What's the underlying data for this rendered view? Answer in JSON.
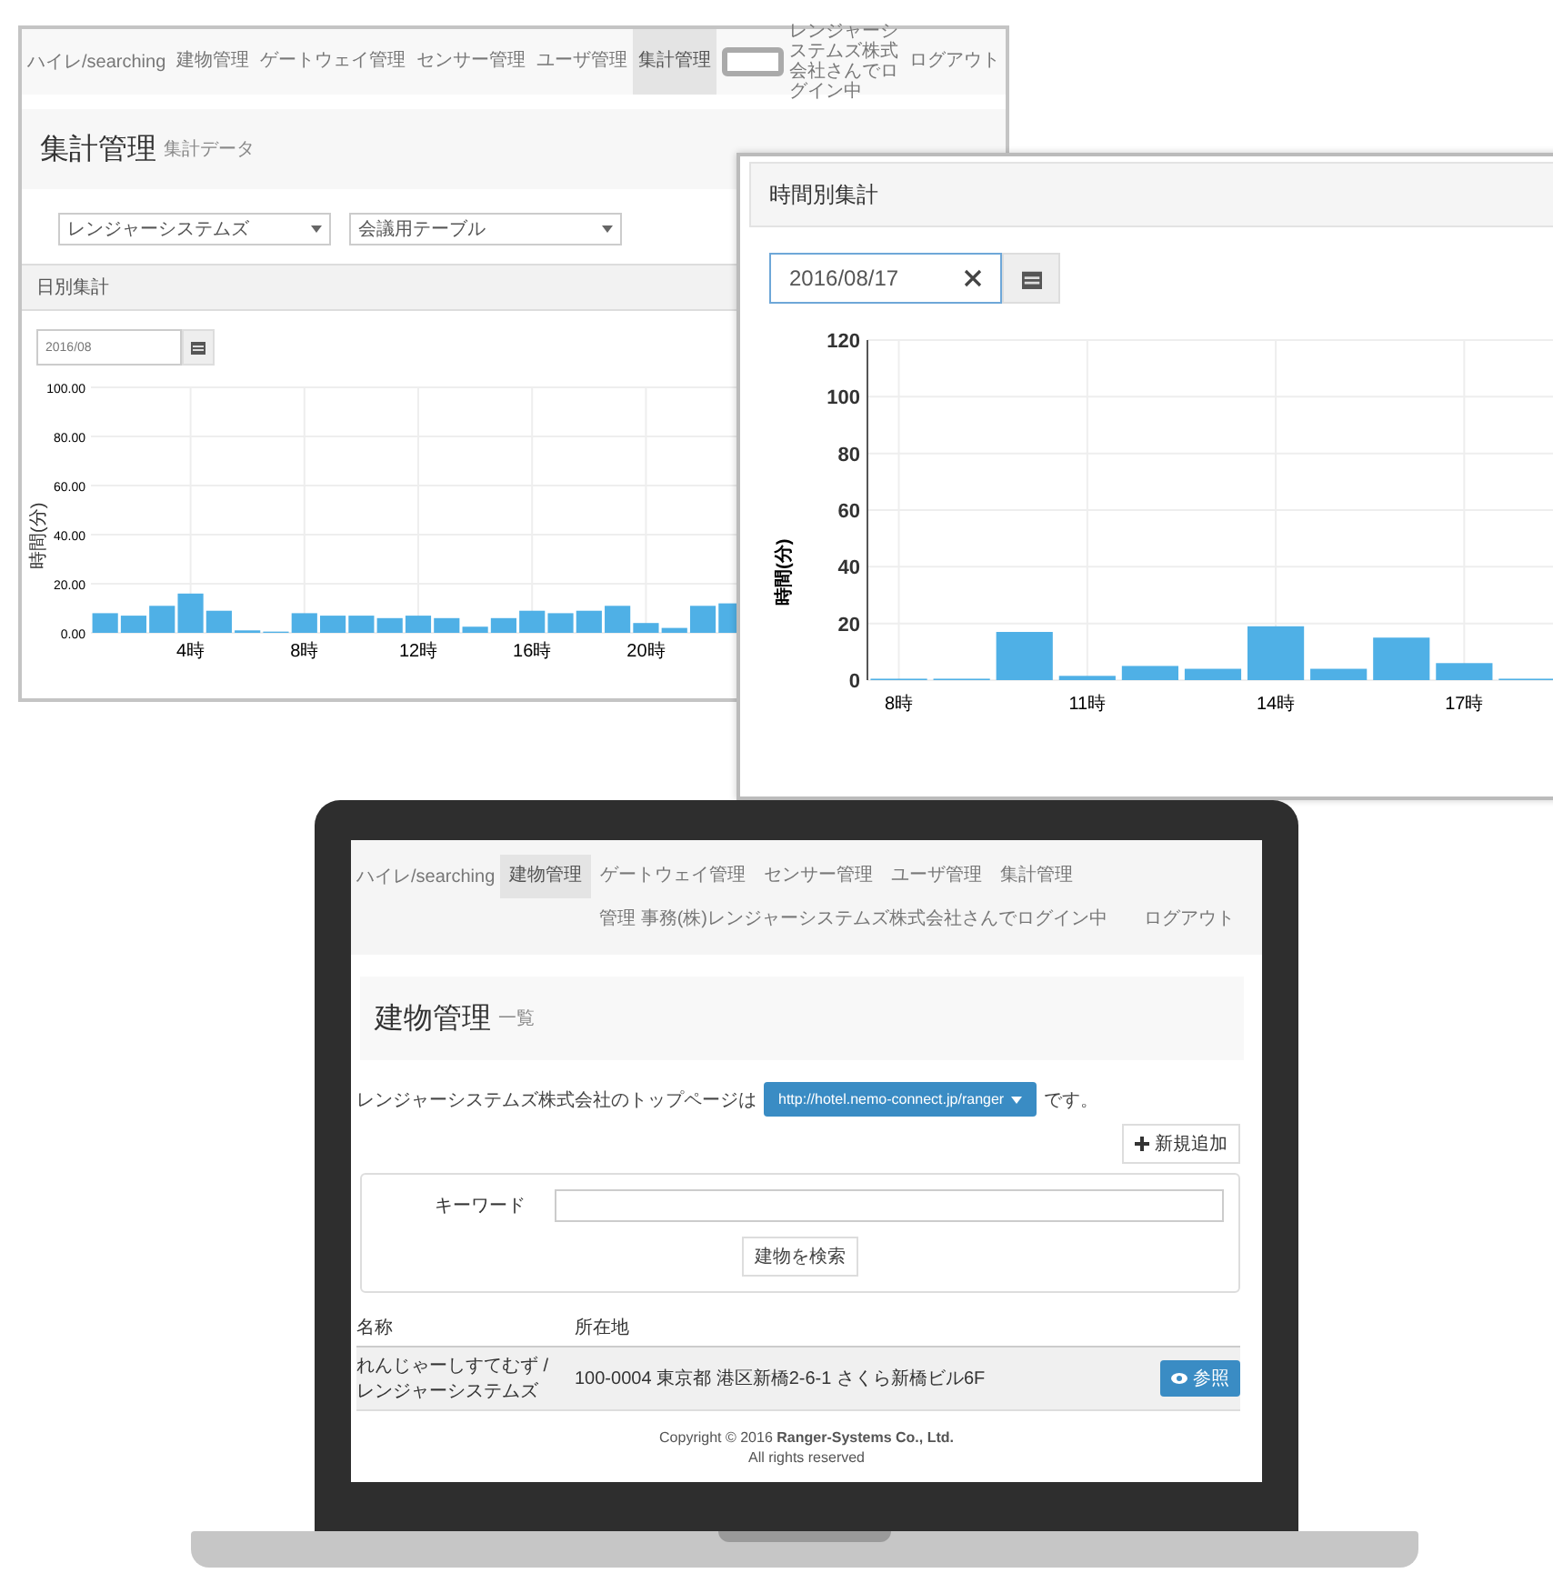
{
  "back_window": {
    "nav": {
      "brand": "ハイレ/searching",
      "items": [
        {
          "label": "建物管理",
          "selected": false
        },
        {
          "label": "ゲートウェイ管理",
          "selected": false
        },
        {
          "label": "センサー管理",
          "selected": false
        },
        {
          "label": "ユーザ管理",
          "selected": false
        },
        {
          "label": "集計管理",
          "selected": true
        }
      ],
      "user_text": "レンジャーシステムズ株式会社さんでログイン中",
      "logout": "ログアウト"
    },
    "heading": {
      "title": "集計管理",
      "subtitle": "集計データ"
    },
    "selects": [
      {
        "value": "レンジャーシステムズ"
      },
      {
        "value": "会議用テーブル"
      }
    ],
    "panel": {
      "title": "日別集計",
      "date": "2016/08",
      "chart_data": {
        "type": "bar",
        "grid": true,
        "ylabel": "時間(分)",
        "x": [
          1,
          2,
          3,
          4,
          5,
          6,
          7,
          8,
          9,
          10,
          11,
          12,
          13,
          14,
          15,
          16,
          17,
          18,
          19,
          20,
          21,
          22,
          23
        ],
        "xlim": [
          0.5,
          23.5
        ],
        "values": [
          8,
          7,
          11,
          16,
          9,
          1,
          0.5,
          8,
          7,
          7,
          6,
          7,
          6,
          2.5,
          6,
          9,
          8,
          9,
          11,
          4,
          2,
          11,
          12
        ],
        "ylim": [
          0,
          100
        ],
        "yticks": [
          {
            "value": 0,
            "label": "0.00"
          },
          {
            "value": 20,
            "label": "20.00"
          },
          {
            "value": 40,
            "label": "40.00"
          },
          {
            "value": 60,
            "label": "60.00"
          },
          {
            "value": 80,
            "label": "80.00"
          },
          {
            "value": 100,
            "label": "100.00"
          }
        ],
        "xticks": [
          {
            "value": 4,
            "label": "4時"
          },
          {
            "value": 8,
            "label": "8時"
          },
          {
            "value": 12,
            "label": "12時"
          },
          {
            "value": 16,
            "label": "16時"
          },
          {
            "value": 20,
            "label": "20時"
          }
        ]
      }
    }
  },
  "front_window": {
    "title": "時間別集計",
    "date_field": {
      "value": "2016/08/17"
    },
    "chart_data": {
      "type": "bar",
      "grid": true,
      "ylabel": "時間(分)",
      "x": [
        8,
        9,
        10,
        11,
        12,
        13,
        14,
        15,
        16,
        17,
        18
      ],
      "xlim": [
        7.5,
        18.5
      ],
      "values": [
        0.5,
        0.5,
        17,
        1.5,
        5,
        4,
        19,
        4,
        15,
        6,
        0.5
      ],
      "ylim": [
        0,
        120
      ],
      "yticks": [
        0,
        20,
        40,
        60,
        80,
        100,
        120
      ],
      "xticks": [
        {
          "value": 8,
          "label": "8時"
        },
        {
          "value": 11,
          "label": "11時"
        },
        {
          "value": 14,
          "label": "14時"
        },
        {
          "value": 17,
          "label": "17時"
        }
      ]
    }
  },
  "laptop_screen": {
    "nav": {
      "brand": "ハイレ/searching",
      "items": [
        {
          "label": "建物管理",
          "selected": true
        },
        {
          "label": "ゲートウェイ管理",
          "selected": false
        },
        {
          "label": "センサー管理",
          "selected": false
        },
        {
          "label": "ユーザ管理",
          "selected": false
        },
        {
          "label": "集計管理",
          "selected": false
        }
      ],
      "user_text": "管理 事務(株)レンジャーシステムズ株式会社さんでログイン中",
      "logout": "ログアウト"
    },
    "heading": {
      "title": "建物管理",
      "subtitle": "一覧"
    },
    "top_page": {
      "before": "レンジャーシステムズ株式会社のトップページは",
      "url_button": "http://hotel.nemo-connect.jp/ranger",
      "after": "です。"
    },
    "add_button": "新規追加",
    "search": {
      "label": "キーワード",
      "button": "建物を検索"
    },
    "table": {
      "columns": [
        "名称",
        "所在地"
      ],
      "rows": [
        {
          "name_kana": "れんじゃーしすてむず /",
          "name": "レンジャーシステムズ",
          "address": "100-0004 東京都 港区新橋2-6-1 さくら新橋ビル6F",
          "button": "参照"
        }
      ]
    },
    "footer": {
      "copyright": "Copyright © 2016 **Ranger-Systems Co., Ltd.**",
      "rights": "All rights reserved"
    }
  }
}
